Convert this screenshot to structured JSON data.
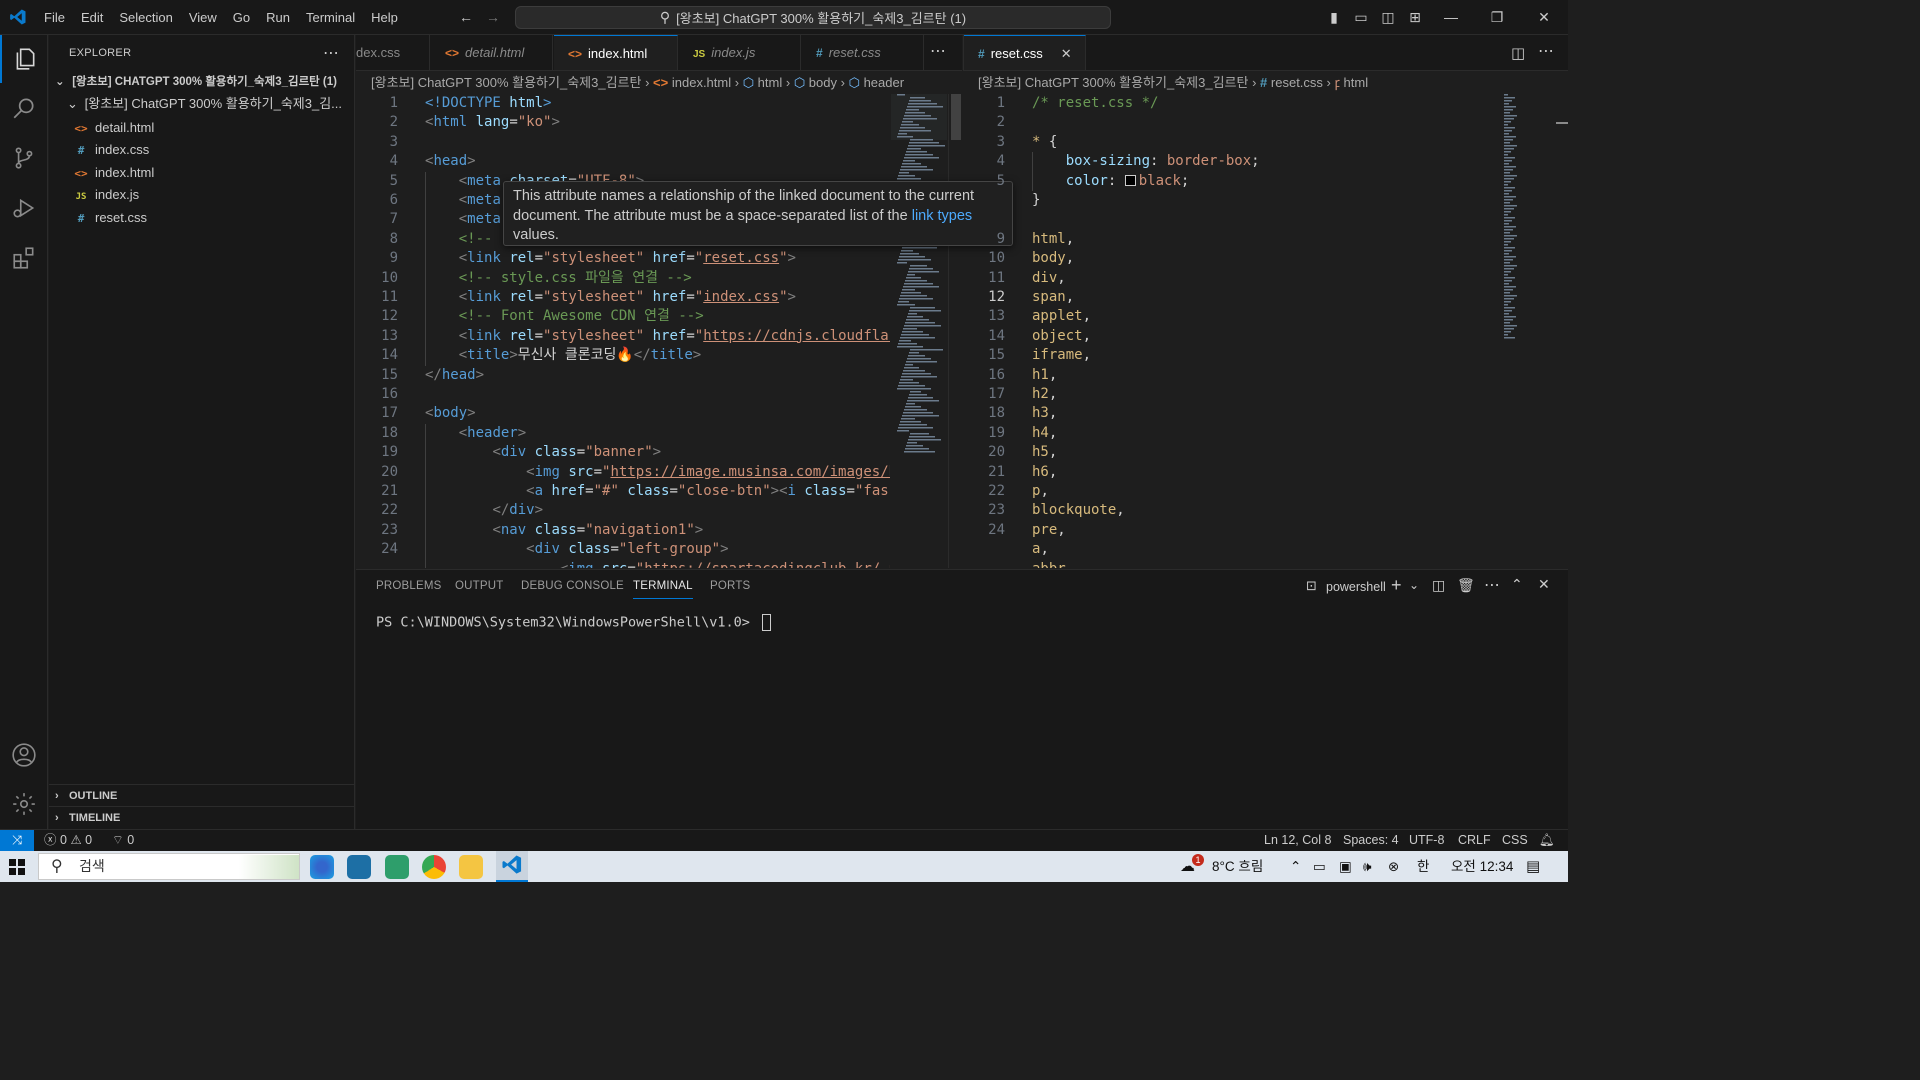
{
  "menu": [
    "File",
    "Edit",
    "Selection",
    "View",
    "Go",
    "Run",
    "Terminal",
    "Help"
  ],
  "command_center": "[왕초보] ChatGPT 300% 활용하기_숙제3_김르탄 (1)",
  "sidebar": {
    "title": "EXPLORER",
    "workspace": "[왕초보] CHATGPT 300% 활용하기_숙제3_김르탄 (1)",
    "folder": "[왕초보] ChatGPT 300% 활용하기_숙제3_김...",
    "files": [
      {
        "icon": "<>",
        "name": "detail.html",
        "color": "#e37933"
      },
      {
        "icon": "#",
        "name": "index.css",
        "color": "#519aba"
      },
      {
        "icon": "<>",
        "name": "index.html",
        "color": "#e37933"
      },
      {
        "icon": "JS",
        "name": "index.js",
        "color": "#cbcb41"
      },
      {
        "icon": "#",
        "name": "reset.css",
        "color": "#519aba"
      }
    ],
    "outline": "OUTLINE",
    "timeline": "TIMELINE"
  },
  "left_group": {
    "tabs": [
      {
        "icon": "#",
        "label": "dex.css",
        "color": "#519aba"
      },
      {
        "icon": "<>",
        "label": "detail.html",
        "color": "#e37933"
      },
      {
        "icon": "<>",
        "label": "index.html",
        "color": "#e37933"
      },
      {
        "icon": "JS",
        "label": "index.js",
        "color": "#cbcb41"
      },
      {
        "icon": "#",
        "label": "reset.css",
        "color": "#519aba"
      }
    ],
    "breadcrumb": [
      "[왕초보] ChatGPT 300% 활용하기_숙제3_김르탄",
      "index.html",
      "html",
      "body",
      "header"
    ],
    "line_numbers": [
      "1",
      "2",
      "3",
      "4",
      "5",
      "6",
      "7",
      "8",
      "9",
      "10",
      "11",
      "12",
      "13",
      "14",
      "15",
      "16",
      "17",
      "18",
      "19",
      "20",
      "21",
      "22",
      "23",
      "24"
    ],
    "hover": {
      "text": "This attribute names a relationship of the linked document to the current document. The attribute must be a space-separated list of the",
      "link": "link types",
      "tail": "values."
    }
  },
  "right_group": {
    "tab": {
      "icon": "#",
      "label": "reset.css",
      "close": "✕"
    },
    "breadcrumb": [
      "[왕초보] ChatGPT 300% 활용하기_숙제3_김르탄",
      "reset.css",
      "html"
    ],
    "line_numbers": [
      "1",
      "2",
      "3",
      "4",
      "5",
      "9",
      "10",
      "11",
      "12",
      "13",
      "14",
      "15",
      "16",
      "17",
      "18",
      "19",
      "20",
      "21",
      "22",
      "23",
      "24"
    ],
    "current_line": "12"
  },
  "panel": {
    "tabs": [
      "PROBLEMS",
      "OUTPUT",
      "DEBUG CONSOLE",
      "TERMINAL",
      "PORTS"
    ],
    "active_tab": "TERMINAL",
    "shell": "powershell",
    "prompt": "PS C:\\WINDOWS\\System32\\WindowsPowerShell\\v1.0>"
  },
  "statusbar": {
    "errors": "0",
    "warnings": "0",
    "ports": "0",
    "position": "Ln 12, Col 8",
    "spaces": "Spaces: 4",
    "encoding": "UTF-8",
    "eol": "CRLF",
    "language": "CSS"
  },
  "taskbar": {
    "search": "검색",
    "weather": "8°C  흐림",
    "badge": "1",
    "ime": "한",
    "clock": "오전 12:34"
  }
}
